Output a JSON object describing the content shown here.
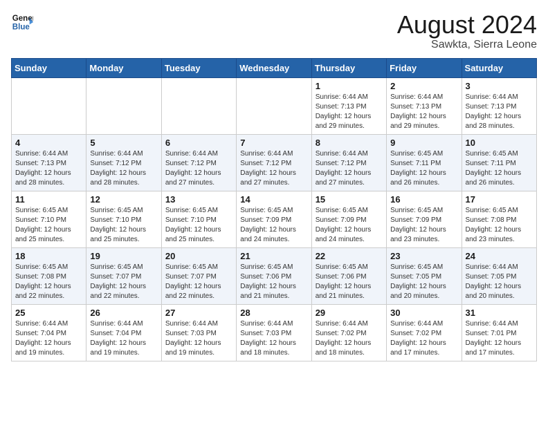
{
  "header": {
    "logo_line1": "General",
    "logo_line2": "Blue",
    "month_year": "August 2024",
    "location": "Sawkta, Sierra Leone"
  },
  "days_of_week": [
    "Sunday",
    "Monday",
    "Tuesday",
    "Wednesday",
    "Thursday",
    "Friday",
    "Saturday"
  ],
  "weeks": [
    [
      {
        "day": "",
        "info": ""
      },
      {
        "day": "",
        "info": ""
      },
      {
        "day": "",
        "info": ""
      },
      {
        "day": "",
        "info": ""
      },
      {
        "day": "1",
        "info": "Sunrise: 6:44 AM\nSunset: 7:13 PM\nDaylight: 12 hours\nand 29 minutes."
      },
      {
        "day": "2",
        "info": "Sunrise: 6:44 AM\nSunset: 7:13 PM\nDaylight: 12 hours\nand 29 minutes."
      },
      {
        "day": "3",
        "info": "Sunrise: 6:44 AM\nSunset: 7:13 PM\nDaylight: 12 hours\nand 28 minutes."
      }
    ],
    [
      {
        "day": "4",
        "info": "Sunrise: 6:44 AM\nSunset: 7:13 PM\nDaylight: 12 hours\nand 28 minutes."
      },
      {
        "day": "5",
        "info": "Sunrise: 6:44 AM\nSunset: 7:12 PM\nDaylight: 12 hours\nand 28 minutes."
      },
      {
        "day": "6",
        "info": "Sunrise: 6:44 AM\nSunset: 7:12 PM\nDaylight: 12 hours\nand 27 minutes."
      },
      {
        "day": "7",
        "info": "Sunrise: 6:44 AM\nSunset: 7:12 PM\nDaylight: 12 hours\nand 27 minutes."
      },
      {
        "day": "8",
        "info": "Sunrise: 6:44 AM\nSunset: 7:12 PM\nDaylight: 12 hours\nand 27 minutes."
      },
      {
        "day": "9",
        "info": "Sunrise: 6:45 AM\nSunset: 7:11 PM\nDaylight: 12 hours\nand 26 minutes."
      },
      {
        "day": "10",
        "info": "Sunrise: 6:45 AM\nSunset: 7:11 PM\nDaylight: 12 hours\nand 26 minutes."
      }
    ],
    [
      {
        "day": "11",
        "info": "Sunrise: 6:45 AM\nSunset: 7:10 PM\nDaylight: 12 hours\nand 25 minutes."
      },
      {
        "day": "12",
        "info": "Sunrise: 6:45 AM\nSunset: 7:10 PM\nDaylight: 12 hours\nand 25 minutes."
      },
      {
        "day": "13",
        "info": "Sunrise: 6:45 AM\nSunset: 7:10 PM\nDaylight: 12 hours\nand 25 minutes."
      },
      {
        "day": "14",
        "info": "Sunrise: 6:45 AM\nSunset: 7:09 PM\nDaylight: 12 hours\nand 24 minutes."
      },
      {
        "day": "15",
        "info": "Sunrise: 6:45 AM\nSunset: 7:09 PM\nDaylight: 12 hours\nand 24 minutes."
      },
      {
        "day": "16",
        "info": "Sunrise: 6:45 AM\nSunset: 7:09 PM\nDaylight: 12 hours\nand 23 minutes."
      },
      {
        "day": "17",
        "info": "Sunrise: 6:45 AM\nSunset: 7:08 PM\nDaylight: 12 hours\nand 23 minutes."
      }
    ],
    [
      {
        "day": "18",
        "info": "Sunrise: 6:45 AM\nSunset: 7:08 PM\nDaylight: 12 hours\nand 22 minutes."
      },
      {
        "day": "19",
        "info": "Sunrise: 6:45 AM\nSunset: 7:07 PM\nDaylight: 12 hours\nand 22 minutes."
      },
      {
        "day": "20",
        "info": "Sunrise: 6:45 AM\nSunset: 7:07 PM\nDaylight: 12 hours\nand 22 minutes."
      },
      {
        "day": "21",
        "info": "Sunrise: 6:45 AM\nSunset: 7:06 PM\nDaylight: 12 hours\nand 21 minutes."
      },
      {
        "day": "22",
        "info": "Sunrise: 6:45 AM\nSunset: 7:06 PM\nDaylight: 12 hours\nand 21 minutes."
      },
      {
        "day": "23",
        "info": "Sunrise: 6:45 AM\nSunset: 7:05 PM\nDaylight: 12 hours\nand 20 minutes."
      },
      {
        "day": "24",
        "info": "Sunrise: 6:44 AM\nSunset: 7:05 PM\nDaylight: 12 hours\nand 20 minutes."
      }
    ],
    [
      {
        "day": "25",
        "info": "Sunrise: 6:44 AM\nSunset: 7:04 PM\nDaylight: 12 hours\nand 19 minutes."
      },
      {
        "day": "26",
        "info": "Sunrise: 6:44 AM\nSunset: 7:04 PM\nDaylight: 12 hours\nand 19 minutes."
      },
      {
        "day": "27",
        "info": "Sunrise: 6:44 AM\nSunset: 7:03 PM\nDaylight: 12 hours\nand 19 minutes."
      },
      {
        "day": "28",
        "info": "Sunrise: 6:44 AM\nSunset: 7:03 PM\nDaylight: 12 hours\nand 18 minutes."
      },
      {
        "day": "29",
        "info": "Sunrise: 6:44 AM\nSunset: 7:02 PM\nDaylight: 12 hours\nand 18 minutes."
      },
      {
        "day": "30",
        "info": "Sunrise: 6:44 AM\nSunset: 7:02 PM\nDaylight: 12 hours\nand 17 minutes."
      },
      {
        "day": "31",
        "info": "Sunrise: 6:44 AM\nSunset: 7:01 PM\nDaylight: 12 hours\nand 17 minutes."
      }
    ]
  ]
}
